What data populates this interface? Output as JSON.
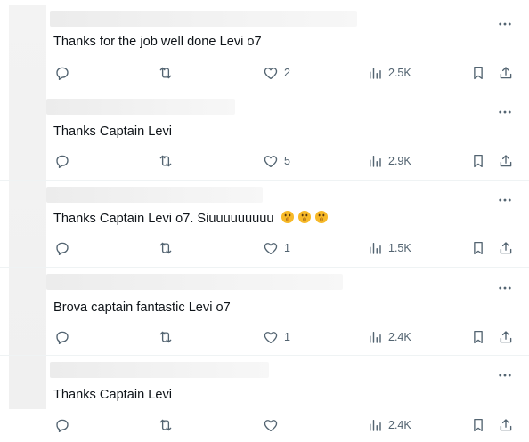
{
  "colors": {
    "icon": "#536471",
    "text": "#0f1419",
    "divider": "#eff3f4",
    "background": "#ffffff"
  },
  "icons": {
    "more": "more-horizontal-icon",
    "reply": "reply-icon",
    "retweet": "retweet-icon",
    "like": "heart-icon",
    "views": "views-icon",
    "bookmark": "bookmark-icon",
    "share": "share-icon"
  },
  "replies": [
    {
      "text": "Thanks for the job well done Levi o7",
      "likes": "2",
      "views": "2.5K"
    },
    {
      "text": "Thanks Captain Levi",
      "likes": "5",
      "views": "2.9K"
    },
    {
      "text": "Thanks Captain Levi o7. Siuuuuuuuuu",
      "emoji_count": 3,
      "emoji": "shushing-face-emoji",
      "likes": "1",
      "views": "1.5K"
    },
    {
      "text": "Brova captain fantastic Levi o7",
      "likes": "1",
      "views": "2.4K"
    },
    {
      "text": "Thanks Captain Levi",
      "likes": "",
      "views": "2.4K"
    }
  ]
}
